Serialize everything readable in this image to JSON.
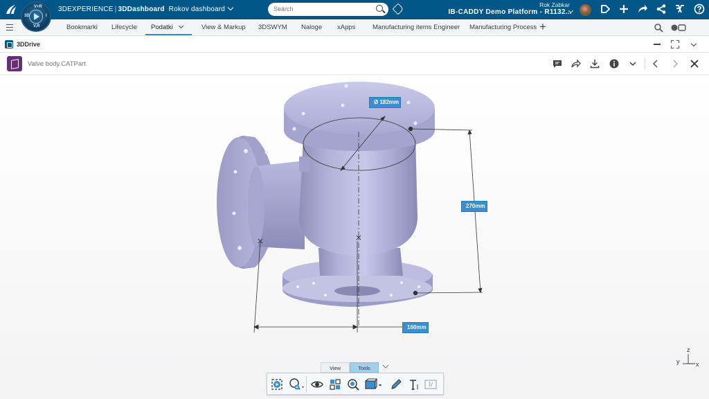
{
  "topbar": {
    "brand_prefix": "3DEXPERIENCE",
    "brand_app": "3DDashboard",
    "dashboard_name": "Rokov dashboard",
    "search_placeholder": "Search",
    "user_name": "Rok Zabkar",
    "platform": "IB-CADDY Demo Platform - R1132...",
    "compass_labels": {
      "top": "V+R",
      "left": "3D",
      "right": "i",
      "bottom": "V,R"
    }
  },
  "tabs": [
    {
      "label": "Bookmarki"
    },
    {
      "label": "Lifecycle"
    },
    {
      "label": "Podatki"
    },
    {
      "label": "View & Markup"
    },
    {
      "label": "3DSWYM"
    },
    {
      "label": "Naloge"
    },
    {
      "label": "xApps"
    },
    {
      "label": "Manufacturing items Engineer"
    },
    {
      "label": "Manufacturing Process"
    }
  ],
  "active_tab": "Podatki",
  "app": {
    "title": "3DDrive"
  },
  "document": {
    "title": "Valve body.CATPart"
  },
  "dimensions": {
    "diameter": "Ø 182mm",
    "height": "270mm",
    "width": "160mm"
  },
  "axes": {
    "z": "z",
    "y": "y",
    "x": "x"
  },
  "viewer_toolbar": {
    "tabs": [
      "View",
      "Tools"
    ],
    "active": "Tools"
  },
  "colors": {
    "topbar": "#005686",
    "accent": "#368ec4",
    "dimension_label": "#3b8fd1",
    "model": "#a7a7cf",
    "doc_icon": "#6a2b7a"
  }
}
